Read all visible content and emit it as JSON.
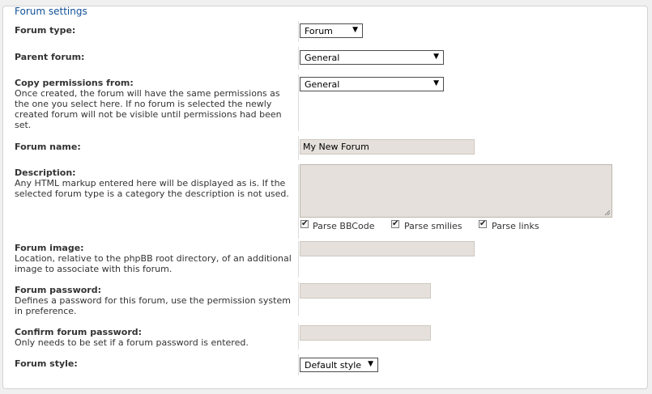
{
  "legend": "Forum settings",
  "forum_type": {
    "label": "Forum type:",
    "value": "Forum"
  },
  "parent_forum": {
    "label": "Parent forum:",
    "value": "General"
  },
  "copy_permissions": {
    "label": "Copy permissions from:",
    "desc_lines": [
      "Once created, the forum will have the same permissions as",
      "the one you select here. If no forum is selected the newly",
      "created forum will not be visible until permissions had been",
      "set."
    ],
    "value": "General"
  },
  "forum_name": {
    "label": "Forum name:",
    "value": "My New Forum"
  },
  "description": {
    "label": "Description:",
    "desc_lines": [
      "Any HTML markup entered here will be displayed as is. If the",
      "selected forum type is a category the description is not used."
    ],
    "options": [
      "Parse BBCode",
      "Parse smilies",
      "Parse links"
    ]
  },
  "forum_image": {
    "label": "Forum image:",
    "desc_lines": [
      "Location, relative to the phpBB root directory, of an additional",
      "image to associate with this forum."
    ]
  },
  "forum_password": {
    "label": "Forum password:",
    "desc_lines": [
      "Defines a password for this forum, use the permission system",
      "in preference."
    ]
  },
  "confirm_password": {
    "label": "Confirm forum password:",
    "desc_lines": [
      "Only needs to be set if a forum password is entered."
    ]
  },
  "forum_style": {
    "label": "Forum style:",
    "value": "Default style"
  }
}
